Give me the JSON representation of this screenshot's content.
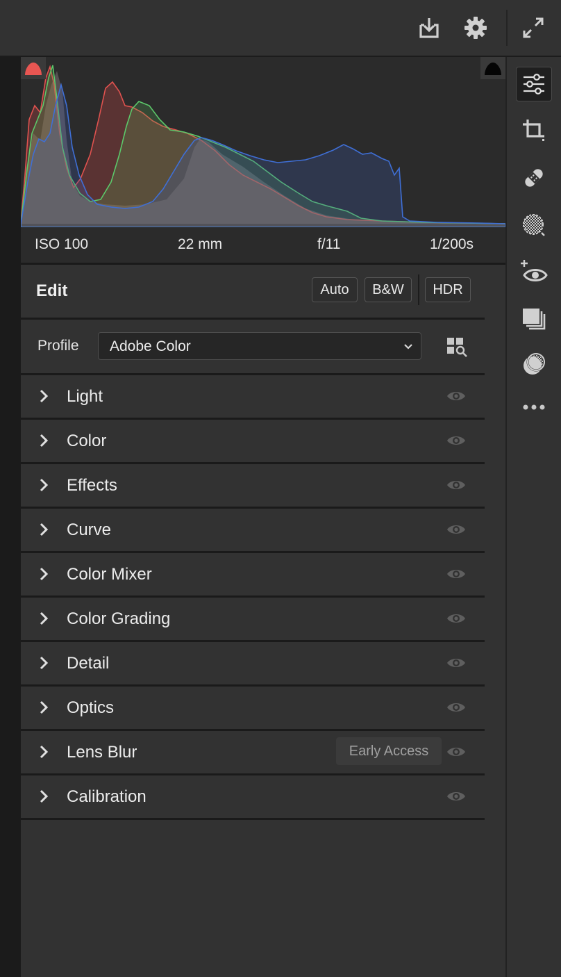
{
  "topbar": {
    "icons": [
      "save-icon",
      "gear-icon",
      "fullscreen-icon"
    ]
  },
  "histogram": {
    "clip_warnings": [
      "shadow-clipping-icon",
      "highlight-clipping-icon"
    ],
    "exif": {
      "iso": "ISO 100",
      "focal_length": "22 mm",
      "aperture": "f/11",
      "shutter": "1/200s"
    },
    "colors": {
      "red": "#e0524f",
      "green": "#5cc86a",
      "blue": "#3f6fd6"
    }
  },
  "edit": {
    "title": "Edit",
    "auto_label": "Auto",
    "bw_label": "B&W",
    "hdr_label": "HDR"
  },
  "profile": {
    "label": "Profile",
    "value": "Adobe Color"
  },
  "panels": [
    {
      "label": "Light"
    },
    {
      "label": "Color"
    },
    {
      "label": "Effects"
    },
    {
      "label": "Curve"
    },
    {
      "label": "Color Mixer"
    },
    {
      "label": "Color Grading"
    },
    {
      "label": "Detail"
    },
    {
      "label": "Optics"
    },
    {
      "label": "Lens Blur",
      "badge": "Early Access"
    },
    {
      "label": "Calibration"
    }
  ],
  "toolbar": {
    "icons": [
      "edit-sliders-icon",
      "crop-icon",
      "healing-icon",
      "masking-icon",
      "red-eye-icon",
      "presets-icon",
      "snapshot-icon",
      "more-icon"
    ],
    "active": "edit-sliders-icon"
  },
  "theme": {
    "background": "#323232",
    "separator": "#1a1a1a",
    "text": "#e6e6e6"
  }
}
